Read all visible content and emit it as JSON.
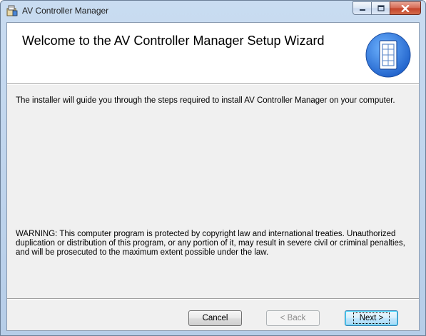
{
  "window": {
    "title": "AV Controller Manager",
    "icon": "installer-package-icon"
  },
  "caption_buttons": {
    "minimize_icon": "minimize-icon",
    "maximize_icon": "maximize-icon",
    "close_icon": "close-icon"
  },
  "banner": {
    "title": "Welcome to the AV Controller Manager Setup Wizard",
    "logo": "door-panel-logo-icon"
  },
  "body": {
    "intro": "The installer will guide you through the steps required to install AV Controller Manager on your computer.",
    "warning": "WARNING: This computer program is protected by copyright law and international treaties. Unauthorized duplication or distribution of this program, or any portion of it, may result in severe civil or criminal penalties, and will be prosecuted to the maximum extent possible under the law."
  },
  "buttons": {
    "cancel_label": "Cancel",
    "back_label": "< Back",
    "next_label": "Next >"
  },
  "colors": {
    "accent": "#3c7fb1",
    "logo_blue": "#2f6fd6",
    "close_red": "#c4432a"
  }
}
